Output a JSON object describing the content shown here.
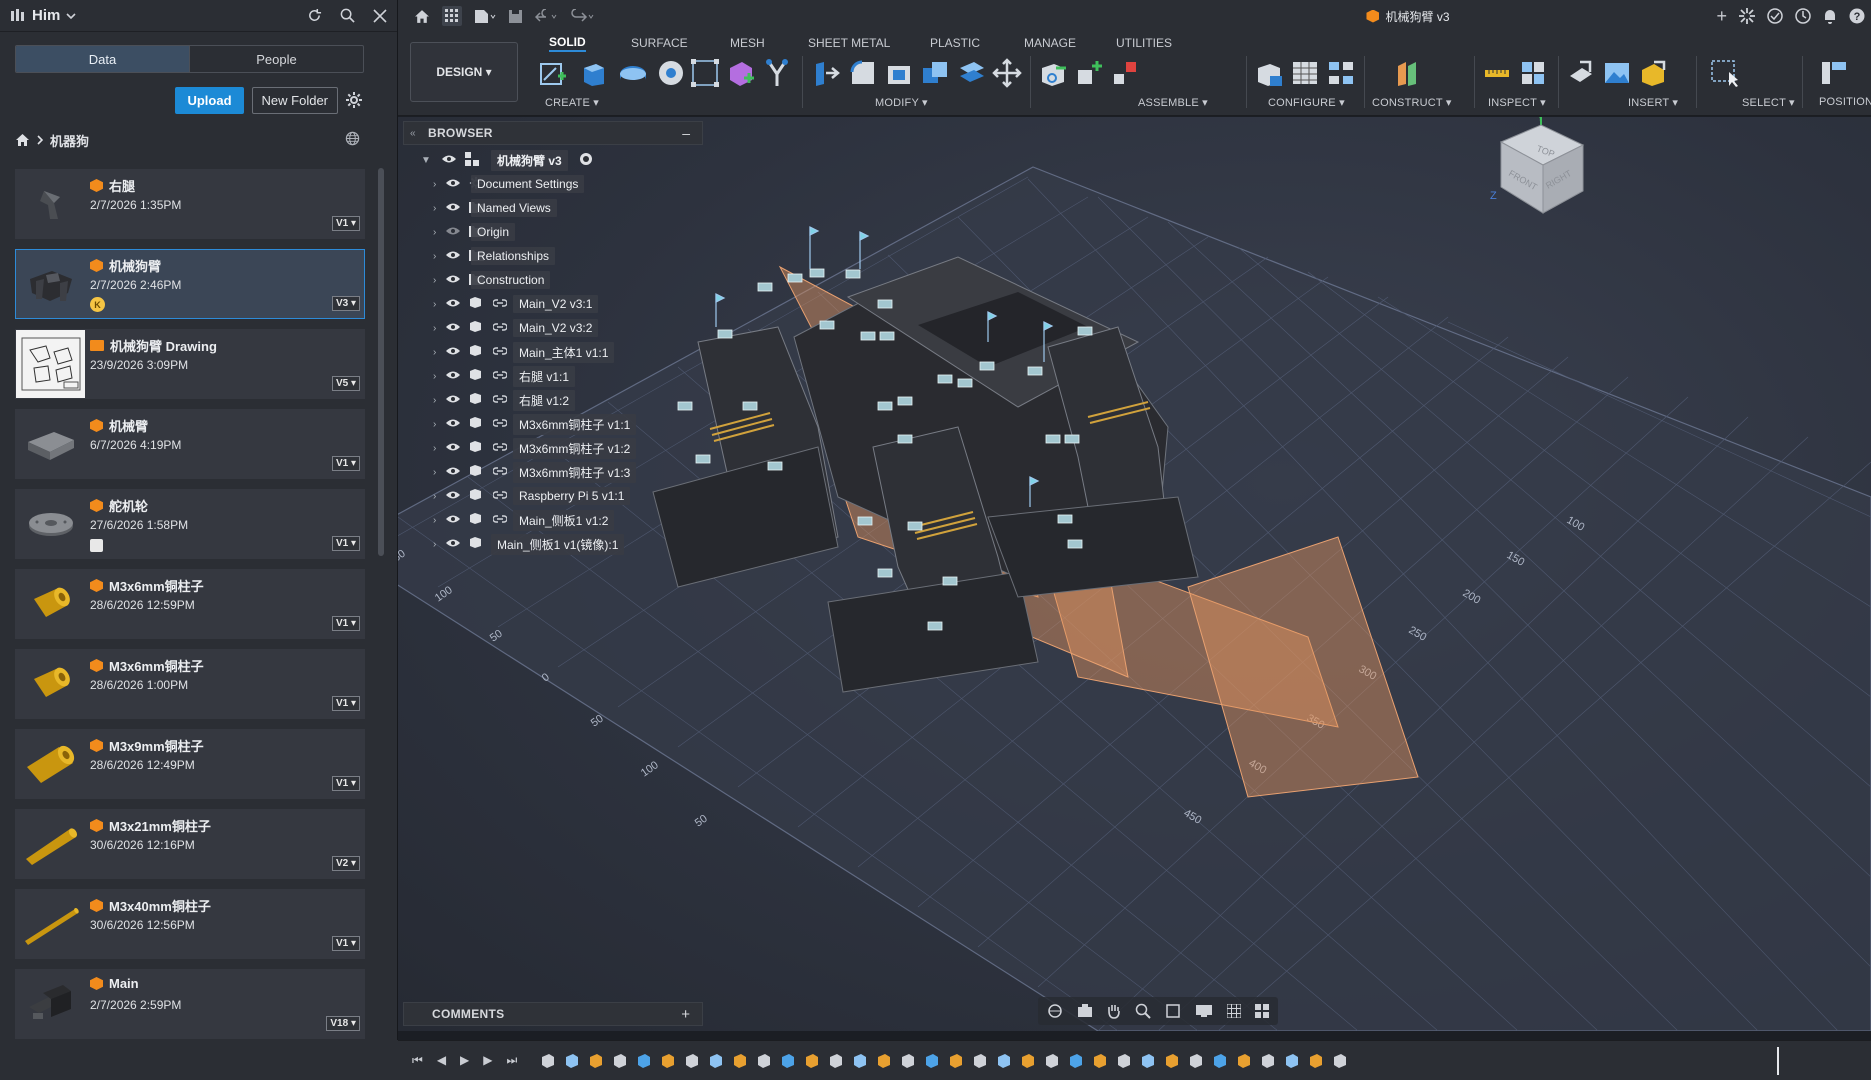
{
  "hub": {
    "name": "Him"
  },
  "panel_tabs": {
    "data": "Data",
    "people": "People"
  },
  "actions": {
    "upload": "Upload",
    "new_folder": "New Folder"
  },
  "breadcrumb": {
    "folder": "机器狗"
  },
  "items": [
    {
      "name": "右腿",
      "date": "2/7/2026 1:35PM",
      "version": "V1"
    },
    {
      "name": "机械狗臂",
      "date": "2/7/2026 2:46PM",
      "version": "V3",
      "badge": "K"
    },
    {
      "name": "机械狗臂 Drawing",
      "date": "23/9/2026 3:09PM",
      "version": "V5"
    },
    {
      "name": "机械臂",
      "date": "6/7/2026 4:19PM",
      "version": "V1"
    },
    {
      "name": "舵机轮",
      "date": "27/6/2026 1:58PM",
      "version": "V1"
    },
    {
      "name": "M3x6mm铜柱子",
      "date": "28/6/2026 12:59PM",
      "version": "V1"
    },
    {
      "name": "M3x6mm铜柱子",
      "date": "28/6/2026 1:00PM",
      "version": "V1"
    },
    {
      "name": "M3x9mm铜柱子",
      "date": "28/6/2026 12:49PM",
      "version": "V1"
    },
    {
      "name": "M3x21mm铜柱子",
      "date": "30/6/2026 12:16PM",
      "version": "V2"
    },
    {
      "name": "M3x40mm铜柱子",
      "date": "30/6/2026 12:56PM",
      "version": "V1"
    },
    {
      "name": "Main",
      "date": "2/7/2026 2:59PM",
      "version": "V18"
    }
  ],
  "document": {
    "title": "机械狗臂 v3"
  },
  "workspace": {
    "design": "DESIGN"
  },
  "ribbon_tabs": [
    "SOLID",
    "SURFACE",
    "MESH",
    "SHEET METAL",
    "PLASTIC",
    "MANAGE",
    "UTILITIES"
  ],
  "groups": {
    "create": "CREATE",
    "modify": "MODIFY",
    "assemble": "ASSEMBLE",
    "configure": "CONFIGURE",
    "construct": "CONSTRUCT",
    "inspect": "INSPECT",
    "insert": "INSERT",
    "select": "SELECT",
    "position": "POSITION"
  },
  "browser": {
    "title": "BROWSER",
    "root": "机械狗臂 v3",
    "nodes": [
      "Document Settings",
      "Named Views",
      "Origin",
      "Relationships",
      "Construction",
      "Main_V2 v3:1",
      "Main_V2 v3:2",
      "Main_主体1 v1:1",
      "右腿 v1:1",
      "右腿 v1:2",
      "M3x6mm铜柱子 v1:1",
      "M3x6mm铜柱子 v1:2",
      "M3x6mm铜柱子 v1:3",
      "Raspberry Pi 5 v1:1",
      "Main_侧板1 v1:2",
      "Main_侧板1 v1(镜像):1"
    ]
  },
  "comments": {
    "title": "COMMENTS"
  },
  "viewcube": {
    "top": "TOP",
    "front": "FRONT",
    "right": "RIGHT",
    "axis_z": "Z",
    "axis_y": "Y"
  },
  "grid_labels": {
    "right": [
      "100",
      "150",
      "200",
      "250",
      "300",
      "350",
      "400",
      "450"
    ],
    "left": [
      "50",
      "100",
      "50",
      "0",
      "50",
      "100",
      "50"
    ]
  },
  "colors": {
    "accent": "#2d8bd8",
    "upload": "#1c8ad6",
    "component": "#f28b1c",
    "plane": "#e3955f"
  }
}
